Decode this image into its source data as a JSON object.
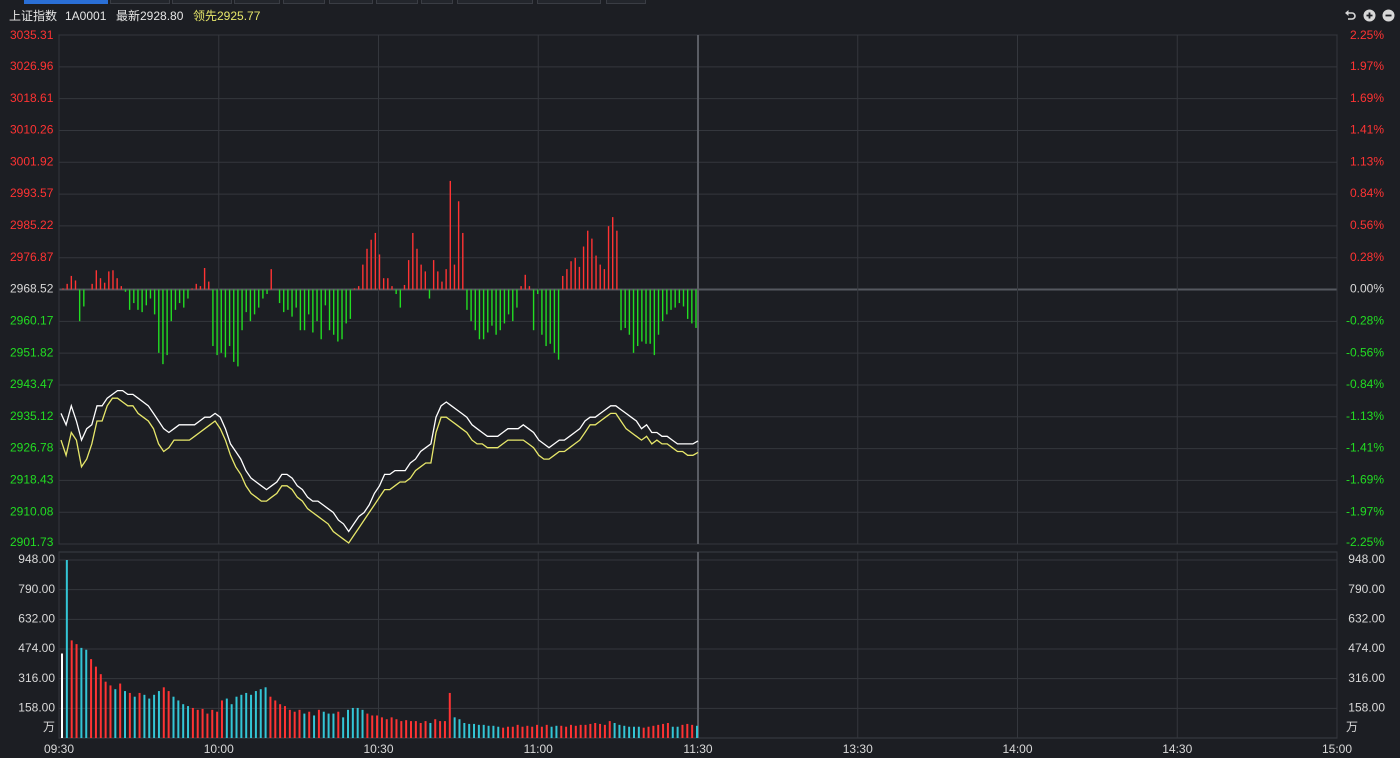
{
  "header": {
    "index_name": "上证指数",
    "code": "1A0001",
    "latest_label": "最新",
    "latest_value": "2928.80",
    "leading_label": "领先",
    "leading_value": "2925.77"
  },
  "colors": {
    "background": "#1c1e23",
    "grid": "#34373d",
    "up": "#ff3333",
    "down": "#22dd22",
    "neutral_text": "#d8d8d8",
    "price_line": "#ffffff",
    "leading_line": "#e7e76a",
    "volume_cyan": "#33c6d6"
  },
  "icons": [
    "back-arrow-icon",
    "zoom-in-icon",
    "zoom-out-icon"
  ],
  "chart_data": [
    {
      "type": "line",
      "name": "intraday-price",
      "y_left_ticks": [
        "3035.31",
        "3026.96",
        "3018.61",
        "3010.26",
        "3001.92",
        "2993.57",
        "2985.22",
        "2976.87",
        "2968.52",
        "2960.17",
        "2951.82",
        "2943.47",
        "2935.12",
        "2926.78",
        "2918.43",
        "2910.08",
        "2901.73"
      ],
      "y_right_ticks": [
        "2.25%",
        "1.97%",
        "1.69%",
        "1.41%",
        "1.13%",
        "0.84%",
        "0.56%",
        "0.28%",
        "0.00%",
        "-0.28%",
        "-0.56%",
        "-0.84%",
        "-1.13%",
        "-1.41%",
        "-1.69%",
        "-1.97%",
        "-2.25%"
      ],
      "ylim": [
        2901.73,
        3035.31
      ],
      "prev_close": 2968.52,
      "x_ticks": [
        "09:30",
        "10:00",
        "10:30",
        "11:00",
        "11:30",
        "13:30",
        "14:00",
        "14:30",
        "15:00"
      ],
      "price": [
        2936,
        2933,
        2938,
        2934,
        2929,
        2932,
        2933,
        2938,
        2938,
        2940,
        2941,
        2942,
        2942,
        2941,
        2941,
        2940,
        2939,
        2938,
        2936,
        2934,
        2932,
        2931,
        2932,
        2933,
        2933,
        2933,
        2933,
        2934,
        2935,
        2935,
        2936,
        2935,
        2932,
        2928,
        2926,
        2924,
        2921,
        2919,
        2918,
        2917,
        2916,
        2917,
        2918,
        2920,
        2920,
        2919,
        2917,
        2916,
        2914,
        2913,
        2913,
        2912,
        2911,
        2910,
        2908,
        2907,
        2905,
        2907,
        2909,
        2910,
        2912,
        2915,
        2917,
        2920,
        2920,
        2921,
        2921,
        2921,
        2923,
        2924,
        2926,
        2927,
        2928,
        2935,
        2938,
        2939,
        2938,
        2937,
        2936,
        2935,
        2933,
        2932,
        2931,
        2930,
        2930,
        2930,
        2931,
        2932,
        2932,
        2932,
        2933,
        2932,
        2931,
        2929,
        2928,
        2927,
        2928,
        2929,
        2929,
        2930,
        2931,
        2932,
        2934,
        2935,
        2935,
        2936,
        2937,
        2938,
        2938,
        2937,
        2936,
        2935,
        2934,
        2932,
        2933,
        2931,
        2931,
        2930,
        2930,
        2929,
        2928,
        2928,
        2928,
        2928,
        2928.8
      ],
      "leading": [
        2929,
        2925,
        2931,
        2929,
        2922,
        2924,
        2928,
        2934,
        2934,
        2938,
        2940,
        2940,
        2939,
        2938,
        2938,
        2936,
        2935,
        2934,
        2932,
        2928,
        2926,
        2927,
        2929,
        2929,
        2929,
        2929,
        2930,
        2931,
        2932,
        2933,
        2934,
        2932,
        2929,
        2925,
        2922,
        2920,
        2917,
        2915,
        2914,
        2913,
        2913,
        2914,
        2915,
        2917,
        2917,
        2916,
        2914,
        2913,
        2911,
        2910,
        2909,
        2908,
        2907,
        2905,
        2904,
        2903,
        2902,
        2904,
        2906,
        2908,
        2910,
        2912,
        2914,
        2916,
        2916,
        2917,
        2918,
        2918,
        2919,
        2921,
        2922,
        2923,
        2923,
        2931,
        2935,
        2935,
        2934,
        2933,
        2932,
        2931,
        2929,
        2928,
        2928,
        2927,
        2927,
        2927,
        2928,
        2929,
        2929,
        2929,
        2929,
        2928,
        2927,
        2925,
        2924,
        2924,
        2925,
        2926,
        2926,
        2927,
        2928,
        2929,
        2931,
        2933,
        2933,
        2934,
        2935,
        2936,
        2936,
        2934,
        2932,
        2931,
        2930,
        2929,
        2930,
        2928,
        2929,
        2928,
        2928,
        2927,
        2926,
        2926,
        2925,
        2925,
        2925.77
      ]
    },
    {
      "type": "bar",
      "name": "buy-sell-strength",
      "unit": "percent",
      "values": [
        0.01,
        0.05,
        0.12,
        0.08,
        -0.28,
        -0.15,
        0,
        0.05,
        0.17,
        0.1,
        0.06,
        0.16,
        0.17,
        0.1,
        0.03,
        -0.02,
        -0.18,
        -0.12,
        -0.18,
        -0.2,
        -0.14,
        -0.08,
        -0.22,
        -0.56,
        -0.66,
        -0.58,
        -0.28,
        -0.18,
        -0.12,
        -0.16,
        -0.08,
        0.01,
        0.05,
        0.03,
        0.19,
        0.07,
        -0.5,
        -0.58,
        -0.56,
        -0.6,
        -0.5,
        -0.64,
        -0.68,
        -0.36,
        -0.2,
        -0.28,
        -0.22,
        -0.16,
        -0.08,
        -0.04,
        0.18,
        0,
        -0.12,
        -0.2,
        -0.18,
        -0.24,
        -0.16,
        -0.36,
        -0.36,
        -0.22,
        -0.38,
        -0.28,
        -0.44,
        -0.14,
        -0.36,
        -0.4,
        -0.46,
        -0.44,
        -0.3,
        -0.26,
        0.01,
        0.03,
        0.22,
        0.36,
        0.44,
        0.5,
        0.31,
        0.1,
        0.1,
        0.03,
        -0.04,
        -0.16,
        0.04,
        0.26,
        0.5,
        0.36,
        0.22,
        0.16,
        -0.08,
        0.26,
        0.16,
        0.07,
        0.18,
        0.96,
        0.22,
        0.78,
        0.5,
        -0.18,
        -0.28,
        -0.36,
        -0.44,
        -0.44,
        -0.38,
        -0.32,
        -0.4,
        -0.36,
        -0.3,
        -0.22,
        -0.28,
        -0.16,
        0.03,
        0.13,
        0.03,
        -0.36,
        -0.04,
        -0.4,
        -0.5,
        -0.48,
        -0.56,
        -0.62,
        0.12,
        0.18,
        0.25,
        0.28,
        0.2,
        0.38,
        0.52,
        0.45,
        0.3,
        0.22,
        0.18,
        0.56,
        0.64,
        0.52,
        -0.36,
        -0.34,
        -0.4,
        -0.56,
        -0.5,
        -0.46,
        -0.48,
        -0.48,
        -0.58,
        -0.4,
        -0.28,
        -0.22,
        -0.18,
        -0.16,
        -0.12,
        -0.15,
        -0.26,
        -0.3,
        -0.34
      ]
    },
    {
      "type": "bar",
      "name": "volume",
      "unit_label": "万",
      "y_ticks": [
        "948.00",
        "790.00",
        "632.00",
        "474.00",
        "316.00",
        "158.00"
      ],
      "ylim": [
        0,
        948
      ],
      "values": [
        450,
        948,
        520,
        500,
        480,
        470,
        420,
        380,
        340,
        300,
        280,
        260,
        290,
        250,
        240,
        220,
        240,
        230,
        210,
        230,
        250,
        270,
        250,
        220,
        200,
        180,
        170,
        160,
        150,
        155,
        130,
        150,
        140,
        200,
        210,
        180,
        220,
        230,
        240,
        230,
        250,
        260,
        270,
        220,
        200,
        180,
        170,
        150,
        140,
        150,
        130,
        140,
        120,
        150,
        140,
        130,
        130,
        140,
        110,
        150,
        160,
        160,
        150,
        130,
        120,
        120,
        110,
        100,
        110,
        100,
        90,
        95,
        90,
        90,
        80,
        90,
        80,
        100,
        90,
        90,
        240,
        110,
        100,
        80,
        75,
        75,
        70,
        70,
        65,
        65,
        60,
        55,
        60,
        60,
        70,
        60,
        65,
        60,
        70,
        60,
        70,
        60,
        65,
        65,
        60,
        70,
        65,
        70,
        70,
        75,
        80,
        75,
        70,
        90,
        80,
        70,
        65,
        60,
        60,
        60,
        55,
        60,
        65,
        70,
        75,
        80,
        60,
        60,
        70,
        75,
        70,
        65
      ],
      "colors": [
        "w",
        "c",
        "r",
        "r",
        "c",
        "c",
        "r",
        "r",
        "r",
        "r",
        "r",
        "c",
        "r",
        "c",
        "r",
        "c",
        "r",
        "c",
        "c",
        "c",
        "c",
        "r",
        "r",
        "c",
        "c",
        "c",
        "c",
        "r",
        "r",
        "r",
        "r",
        "r",
        "r",
        "r",
        "c",
        "c",
        "c",
        "c",
        "c",
        "c",
        "c",
        "c",
        "c",
        "r",
        "r",
        "r",
        "r",
        "r",
        "r",
        "r",
        "c",
        "r",
        "c",
        "r",
        "c",
        "c",
        "c",
        "r",
        "c",
        "c",
        "c",
        "c",
        "c",
        "r",
        "r",
        "r",
        "r",
        "r",
        "r",
        "r",
        "r",
        "r",
        "r",
        "r",
        "r",
        "r",
        "c",
        "r",
        "r",
        "r",
        "r",
        "c",
        "c",
        "c",
        "c",
        "c",
        "c",
        "c",
        "c",
        "c",
        "c",
        "r",
        "r",
        "r",
        "r",
        "r",
        "r",
        "r",
        "r",
        "r",
        "r",
        "c",
        "c",
        "r",
        "r",
        "r",
        "r",
        "r",
        "r",
        "r",
        "r",
        "r",
        "r",
        "r",
        "c",
        "c",
        "c",
        "c",
        "c",
        "c",
        "r",
        "r",
        "r",
        "r",
        "r",
        "r",
        "c",
        "c",
        "r",
        "r",
        "r",
        "c"
      ]
    }
  ]
}
